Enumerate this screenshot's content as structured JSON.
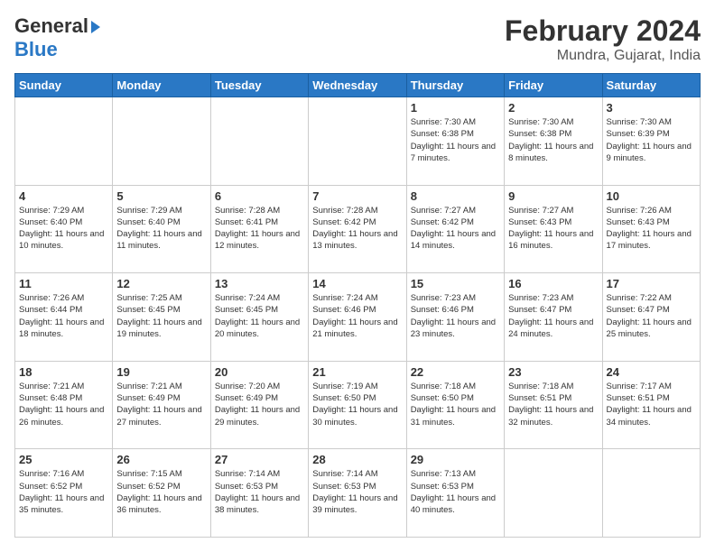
{
  "header": {
    "logo_general": "General",
    "logo_blue": "Blue",
    "main_title": "February 2024",
    "sub_title": "Mundra, Gujarat, India"
  },
  "calendar": {
    "days_of_week": [
      "Sunday",
      "Monday",
      "Tuesday",
      "Wednesday",
      "Thursday",
      "Friday",
      "Saturday"
    ],
    "weeks": [
      [
        {
          "day": "",
          "info": ""
        },
        {
          "day": "",
          "info": ""
        },
        {
          "day": "",
          "info": ""
        },
        {
          "day": "",
          "info": ""
        },
        {
          "day": "1",
          "info": "Sunrise: 7:30 AM\nSunset: 6:38 PM\nDaylight: 11 hours and 7 minutes."
        },
        {
          "day": "2",
          "info": "Sunrise: 7:30 AM\nSunset: 6:38 PM\nDaylight: 11 hours and 8 minutes."
        },
        {
          "day": "3",
          "info": "Sunrise: 7:30 AM\nSunset: 6:39 PM\nDaylight: 11 hours and 9 minutes."
        }
      ],
      [
        {
          "day": "4",
          "info": "Sunrise: 7:29 AM\nSunset: 6:40 PM\nDaylight: 11 hours and 10 minutes."
        },
        {
          "day": "5",
          "info": "Sunrise: 7:29 AM\nSunset: 6:40 PM\nDaylight: 11 hours and 11 minutes."
        },
        {
          "day": "6",
          "info": "Sunrise: 7:28 AM\nSunset: 6:41 PM\nDaylight: 11 hours and 12 minutes."
        },
        {
          "day": "7",
          "info": "Sunrise: 7:28 AM\nSunset: 6:42 PM\nDaylight: 11 hours and 13 minutes."
        },
        {
          "day": "8",
          "info": "Sunrise: 7:27 AM\nSunset: 6:42 PM\nDaylight: 11 hours and 14 minutes."
        },
        {
          "day": "9",
          "info": "Sunrise: 7:27 AM\nSunset: 6:43 PM\nDaylight: 11 hours and 16 minutes."
        },
        {
          "day": "10",
          "info": "Sunrise: 7:26 AM\nSunset: 6:43 PM\nDaylight: 11 hours and 17 minutes."
        }
      ],
      [
        {
          "day": "11",
          "info": "Sunrise: 7:26 AM\nSunset: 6:44 PM\nDaylight: 11 hours and 18 minutes."
        },
        {
          "day": "12",
          "info": "Sunrise: 7:25 AM\nSunset: 6:45 PM\nDaylight: 11 hours and 19 minutes."
        },
        {
          "day": "13",
          "info": "Sunrise: 7:24 AM\nSunset: 6:45 PM\nDaylight: 11 hours and 20 minutes."
        },
        {
          "day": "14",
          "info": "Sunrise: 7:24 AM\nSunset: 6:46 PM\nDaylight: 11 hours and 21 minutes."
        },
        {
          "day": "15",
          "info": "Sunrise: 7:23 AM\nSunset: 6:46 PM\nDaylight: 11 hours and 23 minutes."
        },
        {
          "day": "16",
          "info": "Sunrise: 7:23 AM\nSunset: 6:47 PM\nDaylight: 11 hours and 24 minutes."
        },
        {
          "day": "17",
          "info": "Sunrise: 7:22 AM\nSunset: 6:47 PM\nDaylight: 11 hours and 25 minutes."
        }
      ],
      [
        {
          "day": "18",
          "info": "Sunrise: 7:21 AM\nSunset: 6:48 PM\nDaylight: 11 hours and 26 minutes."
        },
        {
          "day": "19",
          "info": "Sunrise: 7:21 AM\nSunset: 6:49 PM\nDaylight: 11 hours and 27 minutes."
        },
        {
          "day": "20",
          "info": "Sunrise: 7:20 AM\nSunset: 6:49 PM\nDaylight: 11 hours and 29 minutes."
        },
        {
          "day": "21",
          "info": "Sunrise: 7:19 AM\nSunset: 6:50 PM\nDaylight: 11 hours and 30 minutes."
        },
        {
          "day": "22",
          "info": "Sunrise: 7:18 AM\nSunset: 6:50 PM\nDaylight: 11 hours and 31 minutes."
        },
        {
          "day": "23",
          "info": "Sunrise: 7:18 AM\nSunset: 6:51 PM\nDaylight: 11 hours and 32 minutes."
        },
        {
          "day": "24",
          "info": "Sunrise: 7:17 AM\nSunset: 6:51 PM\nDaylight: 11 hours and 34 minutes."
        }
      ],
      [
        {
          "day": "25",
          "info": "Sunrise: 7:16 AM\nSunset: 6:52 PM\nDaylight: 11 hours and 35 minutes."
        },
        {
          "day": "26",
          "info": "Sunrise: 7:15 AM\nSunset: 6:52 PM\nDaylight: 11 hours and 36 minutes."
        },
        {
          "day": "27",
          "info": "Sunrise: 7:14 AM\nSunset: 6:53 PM\nDaylight: 11 hours and 38 minutes."
        },
        {
          "day": "28",
          "info": "Sunrise: 7:14 AM\nSunset: 6:53 PM\nDaylight: 11 hours and 39 minutes."
        },
        {
          "day": "29",
          "info": "Sunrise: 7:13 AM\nSunset: 6:53 PM\nDaylight: 11 hours and 40 minutes."
        },
        {
          "day": "",
          "info": ""
        },
        {
          "day": "",
          "info": ""
        }
      ]
    ]
  }
}
